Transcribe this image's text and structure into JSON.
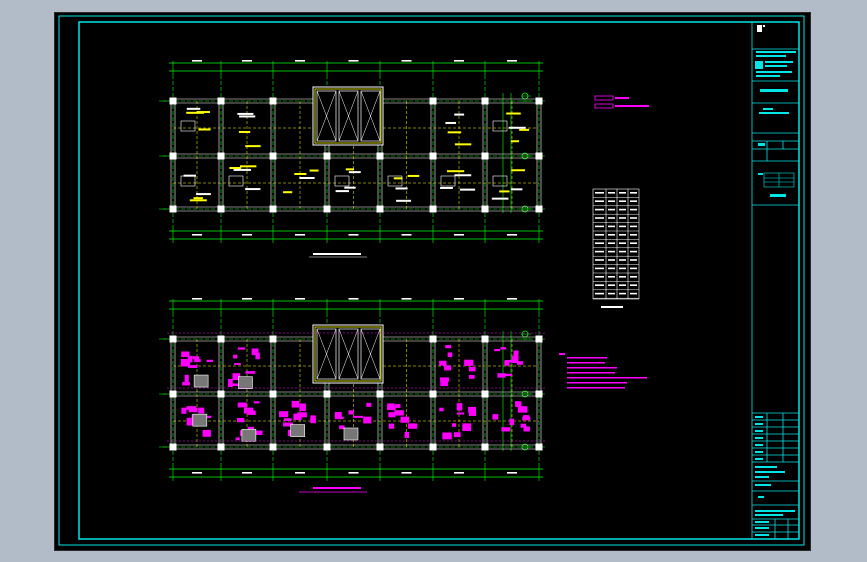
{
  "drawing": {
    "background": "#000000",
    "frame_color": "#00e5e5",
    "axis_color": "#00ff00",
    "column_color": "#ffffff",
    "beam_color": "#ffff00",
    "rebar_color": "#ff00ff",
    "dimension_color": "#00ff00",
    "note_color": "#ff00ff",
    "icons": [
      "layout-icon",
      "grid-bubble-icon",
      "column-icon",
      "stair-icon",
      "elevator-shaft-icon",
      "title-block-icon"
    ]
  }
}
